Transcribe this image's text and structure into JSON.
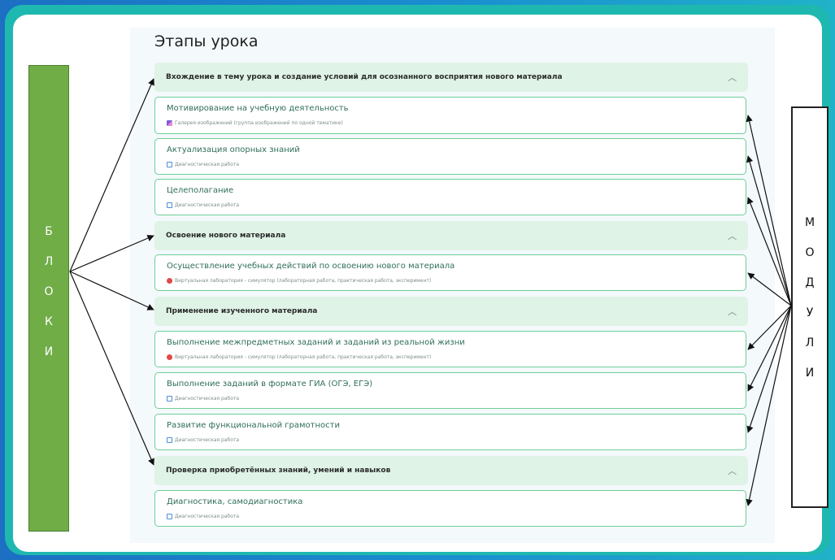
{
  "title": "Этапы урока",
  "left_box": {
    "letters": [
      "Б",
      "Л",
      "О",
      "К",
      "И"
    ],
    "color": "#70ad47"
  },
  "right_box": {
    "letters": [
      "М",
      "О",
      "Д",
      "У",
      "Л",
      "И"
    ]
  },
  "accent_color": "#6ccf98",
  "block_color": "#dff3e6",
  "blocks": [
    {
      "label": "Вхождение в тему урока и создание условий для осознанного восприятия нового материала"
    },
    {
      "label": "Освоение нового материала"
    },
    {
      "label": "Применение изученного материала"
    },
    {
      "label": "Проверка приобретённых знаний, умений и навыков"
    }
  ],
  "modules": [
    {
      "title": "Мотивирование на учебную деятельность",
      "type": "Галерея изображений (группа изображений по одной тематике)",
      "icon": "gallery-icon"
    },
    {
      "title": "Актуализация опорных знаний",
      "type": "Диагностическая работа",
      "icon": "diagnostic-icon"
    },
    {
      "title": "Целеполагание",
      "type": "Диагностическая работа",
      "icon": "diagnostic-icon"
    },
    {
      "title": "Осуществление учебных действий по освоению нового материала",
      "type": "Виртуальная лаборатория - симулятор (лабораторная работа, практическая работа, эксперимент)",
      "icon": "lab-icon"
    },
    {
      "title": "Выполнение межпредметных заданий и заданий из реальной жизни",
      "type": "Виртуальная лаборатория - симулятор (лабораторная работа, практическая работа, эксперимент)",
      "icon": "lab-icon"
    },
    {
      "title": "Выполнение заданий в формате ГИА (ОГЭ, ЕГЭ)",
      "type": "Диагностическая работа",
      "icon": "diagnostic-icon"
    },
    {
      "title": "Развитие функциональной грамотности",
      "type": "Диагностическая работа",
      "icon": "diagnostic-icon"
    },
    {
      "title": "Диагностика, самодиагностика",
      "type": "Диагностическая работа",
      "icon": "diagnostic-icon"
    }
  ]
}
